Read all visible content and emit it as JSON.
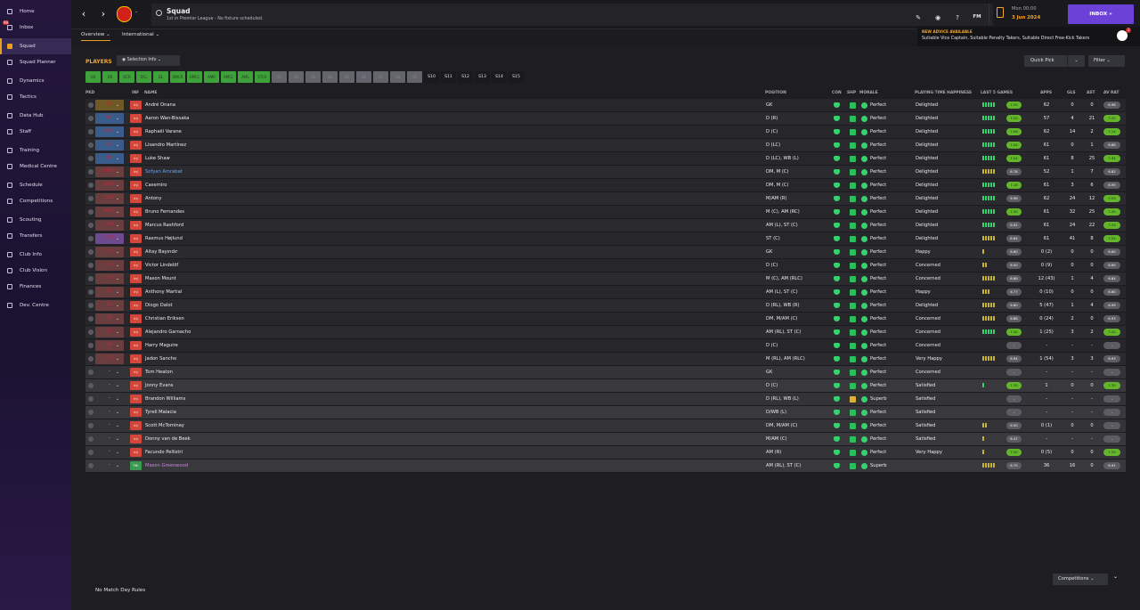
{
  "sidebar": {
    "items": [
      {
        "label": "Home"
      },
      {
        "label": "Inbox",
        "badge": "99"
      },
      {
        "label": "Squad",
        "active": true
      },
      {
        "label": "Squad Planner"
      },
      {
        "label": "Dynamics"
      },
      {
        "label": "Tactics"
      },
      {
        "label": "Data Hub"
      },
      {
        "label": "Staff"
      },
      {
        "label": "Training"
      },
      {
        "label": "Medical Centre"
      },
      {
        "label": "Schedule"
      },
      {
        "label": "Competitions"
      },
      {
        "label": "Scouting"
      },
      {
        "label": "Transfers"
      },
      {
        "label": "Club Info"
      },
      {
        "label": "Club Vision"
      },
      {
        "label": "Finances"
      },
      {
        "label": "Dev. Centre"
      }
    ]
  },
  "header": {
    "title": "Squad",
    "subtitle": "1st in Premier League - No fixture scheduled.",
    "time": "Mon 00:00",
    "date": "3 Jun 2024",
    "inbox_label": "INBOX",
    "icons": [
      "edit-icon",
      "club-icon",
      "help-icon",
      "fm-menu-icon"
    ],
    "fm_label": "FM"
  },
  "advice": {
    "title": "NEW ADVICE AVAILABLE",
    "text": "Suitable Vice Captain, Suitable Penalty Takers, Suitable Direct Free-Kick Takers",
    "badge": "3"
  },
  "tabs": [
    {
      "label": "Overview",
      "active": true
    },
    {
      "label": "International"
    }
  ],
  "players_label": "PLAYERS",
  "selection_info_label": "Selection Info",
  "quick_pick_label": "Quick Pick",
  "filter_label": "Filter",
  "selection_buttons": [
    {
      "label": "GK",
      "state": "g"
    },
    {
      "label": "DR",
      "state": "g"
    },
    {
      "label": "DCR",
      "state": "g"
    },
    {
      "label": "DCL",
      "state": "g"
    },
    {
      "label": "DL",
      "state": "g"
    },
    {
      "label": "DMCR",
      "state": "g"
    },
    {
      "label": "DMCL",
      "state": "g"
    },
    {
      "label": "AMR",
      "state": "g"
    },
    {
      "label": "AMCL",
      "state": "g"
    },
    {
      "label": "AML",
      "state": "g"
    },
    {
      "label": "STCR",
      "state": "g"
    },
    {
      "label": "S1",
      "state": "x"
    },
    {
      "label": "S2",
      "state": "x"
    },
    {
      "label": "S3",
      "state": "x"
    },
    {
      "label": "S4",
      "state": "x"
    },
    {
      "label": "S5",
      "state": "x"
    },
    {
      "label": "S6",
      "state": "x"
    },
    {
      "label": "S7",
      "state": "x"
    },
    {
      "label": "S8",
      "state": "x"
    },
    {
      "label": "S9",
      "state": "x"
    },
    {
      "label": "S10",
      "state": "n"
    },
    {
      "label": "S11",
      "state": "n"
    },
    {
      "label": "S12",
      "state": "n"
    },
    {
      "label": "S13",
      "state": "n"
    },
    {
      "label": "S14",
      "state": "n"
    },
    {
      "label": "S15",
      "state": "n"
    }
  ],
  "columns": {
    "pkd": "PKD",
    "inf": "INF",
    "name": "NAME",
    "position": "POSITION",
    "con": "CON",
    "shp": "SHP",
    "morale": "MORALE",
    "pth": "PLAYING TIME HAPPINESS",
    "l5g": "LAST 5 GAMES",
    "apps": "APPS",
    "gls": "GLS",
    "ast": "AST",
    "avrat": "AV RAT"
  },
  "players": [
    {
      "sel": "GK",
      "posclass": "gk",
      "inf": "Inj",
      "name": "André Onana",
      "position": "GK",
      "morale": "Perfect",
      "pth": "Delighted",
      "l5": "ggggg",
      "rating": "7.25",
      "rgood": true,
      "apps": "62",
      "gls": "0",
      "ast": "0",
      "avr": "6.98",
      "agood": false,
      "shp": "g"
    },
    {
      "sel": "DR",
      "posclass": "def",
      "inf": "Inj",
      "name": "Aaron Wan-Bissaka",
      "position": "D (R)",
      "morale": "Perfect",
      "pth": "Delighted",
      "l5": "ggggg",
      "rating": "7.02",
      "rgood": true,
      "apps": "57",
      "gls": "4",
      "ast": "21",
      "avr": "7.20",
      "agood": true,
      "shp": "g"
    },
    {
      "sel": "DCR",
      "posclass": "def",
      "inf": "Inj",
      "name": "Raphaël Varane",
      "position": "D (C)",
      "morale": "Perfect",
      "pth": "Delighted",
      "l5": "ggggg",
      "rating": "7.06",
      "rgood": true,
      "apps": "62",
      "gls": "14",
      "ast": "2",
      "avr": "7.14",
      "agood": true,
      "shp": "g"
    },
    {
      "sel": "DCL",
      "posclass": "def",
      "inf": "Inj",
      "name": "Lisandro Martínez",
      "position": "D (LC)",
      "morale": "Perfect",
      "pth": "Delighted",
      "l5": "ggggg",
      "rating": "7.04",
      "rgood": true,
      "apps": "61",
      "gls": "0",
      "ast": "1",
      "avr": "6.88",
      "agood": false,
      "shp": "g"
    },
    {
      "sel": "DL",
      "posclass": "def",
      "inf": "Inj",
      "name": "Luke Shaw",
      "position": "D (LC), WB (L)",
      "morale": "Perfect",
      "pth": "Delighted",
      "l5": "ggggg",
      "rating": "7.04",
      "rgood": true,
      "apps": "61",
      "gls": "8",
      "ast": "25",
      "avr": "7.34",
      "agood": true,
      "shp": "g"
    },
    {
      "sel": "DMCR",
      "posclass": "mid",
      "inf": "Inj",
      "name": "Sofyan Amrabat",
      "position": "DM, M (C)",
      "morale": "Perfect",
      "pth": "Delighted",
      "l5": "yyyyy",
      "rating": "6.78",
      "rgood": false,
      "apps": "52",
      "gls": "1",
      "ast": "7",
      "avr": "6.82",
      "agood": false,
      "shp": "g",
      "loan": true
    },
    {
      "sel": "DMCL",
      "posclass": "mid",
      "inf": "Inj",
      "name": "Casemiro",
      "position": "DM, M (C)",
      "morale": "Perfect",
      "pth": "Delighted",
      "l5": "ggggg",
      "rating": "7.18",
      "rgood": true,
      "apps": "61",
      "gls": "3",
      "ast": "6",
      "avr": "6.95",
      "agood": false,
      "shp": "g"
    },
    {
      "sel": "AMR",
      "posclass": "mid",
      "inf": "Inj",
      "name": "Antony",
      "position": "M/AM (R)",
      "morale": "Perfect",
      "pth": "Delighted",
      "l5": "ggggg",
      "rating": "6.98",
      "rgood": false,
      "apps": "62",
      "gls": "24",
      "ast": "12",
      "avr": "7.03",
      "agood": true,
      "shp": "g"
    },
    {
      "sel": "AMCL",
      "posclass": "mid",
      "inf": "Inj",
      "name": "Bruno Fernandes",
      "position": "M (C), AM (RC)",
      "morale": "Perfect",
      "pth": "Delighted",
      "l5": "ggggg",
      "rating": "7.30",
      "rgood": true,
      "apps": "61",
      "gls": "32",
      "ast": "25",
      "avr": "7.45",
      "agood": true,
      "shp": "g"
    },
    {
      "sel": "AML",
      "posclass": "mid",
      "inf": "Inj",
      "name": "Marcus Rashford",
      "position": "AM (L), ST (C)",
      "morale": "Perfect",
      "pth": "Delighted",
      "l5": "ggggg",
      "rating": "6.92",
      "rgood": false,
      "apps": "61",
      "gls": "24",
      "ast": "22",
      "avr": "7.33",
      "agood": true,
      "shp": "g"
    },
    {
      "sel": "STCR",
      "posclass": "str",
      "inf": "Inj",
      "name": "Rasmus Højlund",
      "position": "ST (C)",
      "morale": "Perfect",
      "pth": "Delighted",
      "l5": "yyyyy",
      "rating": "6.64",
      "rgood": false,
      "apps": "61",
      "gls": "41",
      "ast": "8",
      "avr": "7.24",
      "agood": true,
      "shp": "g"
    },
    {
      "sel": "S1",
      "posclass": "mid",
      "inf": "Inj",
      "name": "Altay Bayındır",
      "position": "GK",
      "morale": "Perfect",
      "pth": "Happy",
      "l5": "y",
      "rating": "6.60",
      "rgood": false,
      "apps": "0 (2)",
      "gls": "0",
      "ast": "0",
      "avr": "6.60",
      "agood": false,
      "shp": "g"
    },
    {
      "sel": "S2",
      "posclass": "mid",
      "inf": "Inj",
      "name": "Victor Lindelöf",
      "position": "D (C)",
      "morale": "Perfect",
      "pth": "Concerned",
      "l5": "yy",
      "rating": "6.50",
      "rgood": false,
      "apps": "0 (9)",
      "gls": "0",
      "ast": "0",
      "avr": "6.60",
      "agood": false,
      "shp": "g"
    },
    {
      "sel": "S3",
      "posclass": "mid",
      "inf": "Inj",
      "name": "Mason Mount",
      "position": "M (C), AM (RLC)",
      "morale": "Perfect",
      "pth": "Concerned",
      "l5": "yyyyy",
      "rating": "6.86",
      "rgood": false,
      "apps": "12 (43)",
      "gls": "1",
      "ast": "4",
      "avr": "6.84",
      "agood": false,
      "shp": "g"
    },
    {
      "sel": "S4",
      "posclass": "mid",
      "inf": "Inj",
      "name": "Anthony Martial",
      "position": "AM (L), ST (C)",
      "morale": "Perfect",
      "pth": "Happy",
      "l5": "yyy",
      "rating": "6.77",
      "rgood": false,
      "apps": "0 (10)",
      "gls": "0",
      "ast": "0",
      "avr": "6.60",
      "agood": false,
      "shp": "g"
    },
    {
      "sel": "S5",
      "posclass": "mid",
      "inf": "Inj",
      "name": "Diogo Dalot",
      "position": "D (RL), WB (R)",
      "morale": "Perfect",
      "pth": "Delighted",
      "l5": "yyyyy",
      "rating": "6.80",
      "rgood": false,
      "apps": "5 (47)",
      "gls": "1",
      "ast": "4",
      "avr": "6.99",
      "agood": false,
      "shp": "g"
    },
    {
      "sel": "S6",
      "posclass": "mid",
      "inf": "Inj",
      "name": "Christian Eriksen",
      "position": "DM, M/AM (C)",
      "morale": "Perfect",
      "pth": "Concerned",
      "l5": "yyyyy",
      "rating": "6.88",
      "rgood": false,
      "apps": "0 (24)",
      "gls": "2",
      "ast": "0",
      "avr": "6.93",
      "agood": false,
      "shp": "g"
    },
    {
      "sel": "S7",
      "posclass": "mid",
      "inf": "Inj",
      "name": "Alejandro Garnacho",
      "position": "AM (RL), ST (C)",
      "morale": "Perfect",
      "pth": "Concerned",
      "l5": "ggggg",
      "rating": "7.42",
      "rgood": true,
      "apps": "1 (25)",
      "gls": "3",
      "ast": "2",
      "avr": "7.42",
      "agood": true,
      "shp": "g"
    },
    {
      "sel": "S8",
      "posclass": "mid",
      "inf": "Inj",
      "name": "Harry Maguire",
      "position": "D (C)",
      "morale": "Perfect",
      "pth": "Concerned",
      "l5": "",
      "rating": "-",
      "rgood": false,
      "apps": "-",
      "gls": "-",
      "ast": "-",
      "avr": "-",
      "agood": false,
      "shp": "g"
    },
    {
      "sel": "S9",
      "posclass": "mid",
      "inf": "Inj",
      "name": "Jadon Sancho",
      "position": "M (RL), AM (RLC)",
      "morale": "Perfect",
      "pth": "Very Happy",
      "l5": "yyyyy",
      "rating": "6.94",
      "rgood": false,
      "apps": "1 (54)",
      "gls": "3",
      "ast": "3",
      "avr": "6.93",
      "agood": false,
      "shp": "g"
    },
    {
      "sel": "-",
      "posclass": "none",
      "inf": "Inj",
      "name": "Tom Heaton",
      "position": "GK",
      "morale": "Perfect",
      "pth": "Concerned",
      "l5": "",
      "rating": "-",
      "rgood": false,
      "apps": "-",
      "gls": "-",
      "ast": "-",
      "avr": "-",
      "agood": false,
      "shp": "g",
      "grey": true
    },
    {
      "sel": "-",
      "posclass": "none",
      "inf": "Inj",
      "name": "Jonny Evans",
      "position": "D (C)",
      "morale": "Perfect",
      "pth": "Satisfied",
      "l5": "g",
      "rating": "7.30",
      "rgood": true,
      "apps": "1",
      "gls": "0",
      "ast": "0",
      "avr": "7.30",
      "agood": true,
      "shp": "g",
      "grey": true
    },
    {
      "sel": "-",
      "posclass": "none",
      "inf": "Inj",
      "name": "Brandon Williams",
      "position": "D (RL), WB (L)",
      "morale": "Superb",
      "pth": "Satisfied",
      "l5": "",
      "rating": "-",
      "rgood": false,
      "apps": "-",
      "gls": "-",
      "ast": "-",
      "avr": "-",
      "agood": false,
      "shp": "y",
      "grey": true
    },
    {
      "sel": "-",
      "posclass": "none",
      "inf": "Inj",
      "name": "Tyrell Malacia",
      "position": "D/WB (L)",
      "morale": "Perfect",
      "pth": "Satisfied",
      "l5": "",
      "rating": "-",
      "rgood": false,
      "apps": "-",
      "gls": "-",
      "ast": "-",
      "avr": "-",
      "agood": false,
      "shp": "g",
      "grey": true
    },
    {
      "sel": "-",
      "posclass": "none",
      "inf": "Inj",
      "name": "Scott McTominay",
      "position": "DM, M/AM (C)",
      "morale": "Perfect",
      "pth": "Satisfied",
      "l5": "yy",
      "rating": "6.50",
      "rgood": false,
      "apps": "0 (1)",
      "gls": "0",
      "ast": "0",
      "avr": "-",
      "agood": false,
      "shp": "g",
      "grey": true
    },
    {
      "sel": "-",
      "posclass": "none",
      "inf": "Inj",
      "name": "Donny van de Beek",
      "position": "M/AM (C)",
      "morale": "Perfect",
      "pth": "Satisfied",
      "l5": "y",
      "rating": "6.47",
      "rgood": false,
      "apps": "-",
      "gls": "-",
      "ast": "-",
      "avr": "-",
      "agood": false,
      "shp": "g",
      "grey": true
    },
    {
      "sel": "-",
      "posclass": "none",
      "inf": "Inj",
      "name": "Facundo Pellistri",
      "position": "AM (R)",
      "morale": "Perfect",
      "pth": "Very Happy",
      "l5": "y",
      "rating": "7.50",
      "rgood": true,
      "apps": "0 (5)",
      "gls": "0",
      "ast": "0",
      "avr": "7.50",
      "agood": true,
      "shp": "g",
      "grey": true
    },
    {
      "sel": "-",
      "posclass": "none",
      "inf": "Yth",
      "name": "Mason Greenwood",
      "position": "AM (RL), ST (C)",
      "morale": "Superb",
      "pth": "",
      "l5": "yyyyy",
      "rating": "6.75",
      "rgood": false,
      "apps": "36",
      "gls": "16",
      "ast": "0",
      "avr": "6.91",
      "agood": false,
      "shp": "g",
      "grey": true,
      "unavail": true,
      "yth": true
    }
  ],
  "matchday_rules": "No Match Day Rules",
  "competitions_label": "Competitions"
}
